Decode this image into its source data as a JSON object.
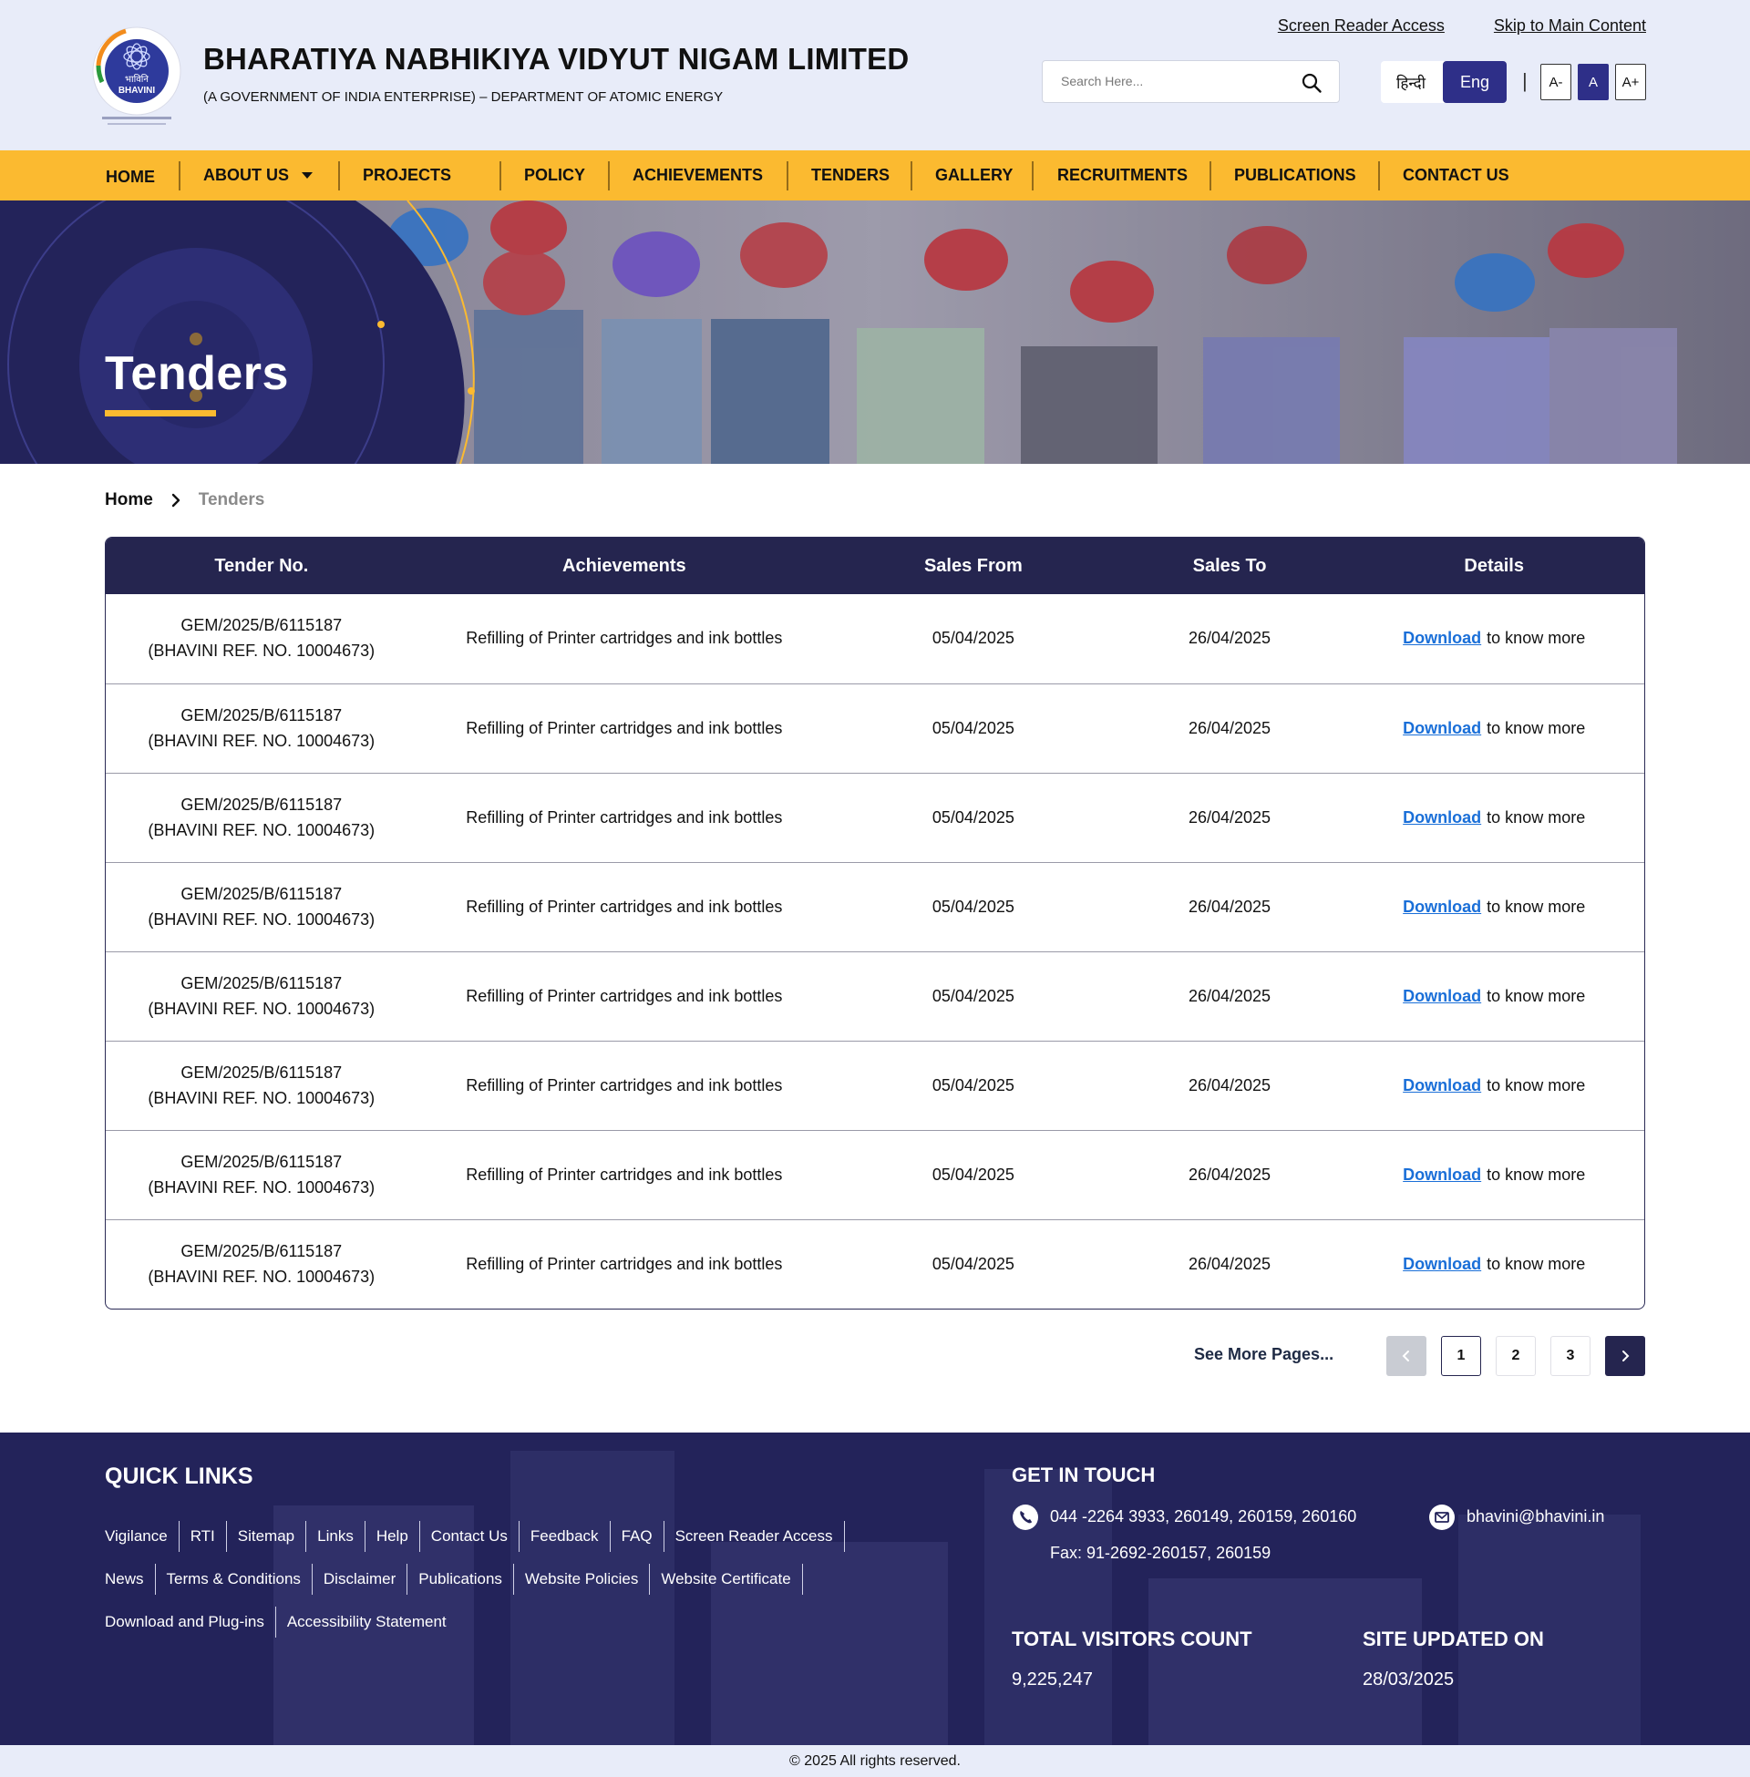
{
  "header": {
    "logo_text": "भाविनि BHAVINI",
    "org_name": "BHARATIYA NABHIKIYA VIDYUT NIGAM LIMITED",
    "org_subtitle": "(A GOVERNMENT OF INDIA ENTERPRISE) – DEPARTMENT OF ATOMIC ENERGY",
    "screen_reader_link": "Screen Reader Access",
    "skip_link": "Skip to Main Content",
    "search_placeholder": "Search Here...",
    "lang_hindi": "हिन्दी",
    "lang_english": "Eng",
    "divider": "|",
    "font_decrease": "A-",
    "font_normal": "A",
    "font_increase": "A+"
  },
  "nav": {
    "items": [
      {
        "label": "HOME"
      },
      {
        "label": "ABOUT US"
      },
      {
        "label": "PROJECTS"
      },
      {
        "label": "POLICY"
      },
      {
        "label": "ACHIEVEMENTS"
      },
      {
        "label": "TENDERS"
      },
      {
        "label": "GALLERY"
      },
      {
        "label": "RECRUITMENTS"
      },
      {
        "label": "PUBLICATIONS"
      },
      {
        "label": "CONTACT US"
      }
    ]
  },
  "banner": {
    "title": "Tenders"
  },
  "breadcrumb": {
    "home": "Home",
    "current": "Tenders"
  },
  "table": {
    "headers": [
      "Tender No.",
      "Achievements",
      "Sales From",
      "Sales To",
      "Details"
    ],
    "rows": [
      {
        "tender_line1": "GEM/2025/B/6115187",
        "tender_line2": "(BHAVINI REF. NO. 10004673)",
        "achievement": "Refilling of Printer cartridges and ink bottles",
        "sales_from": "05/04/2025",
        "sales_to": "26/04/2025",
        "link": "Download",
        "suffix": "to know more"
      },
      {
        "tender_line1": "GEM/2025/B/6115187",
        "tender_line2": "(BHAVINI REF. NO. 10004673)",
        "achievement": "Refilling of Printer cartridges and ink bottles",
        "sales_from": "05/04/2025",
        "sales_to": "26/04/2025",
        "link": "Download",
        "suffix": "to know more"
      },
      {
        "tender_line1": "GEM/2025/B/6115187",
        "tender_line2": "(BHAVINI REF. NO. 10004673)",
        "achievement": "Refilling of Printer cartridges and ink bottles",
        "sales_from": "05/04/2025",
        "sales_to": "26/04/2025",
        "link": "Download",
        "suffix": "to know more"
      },
      {
        "tender_line1": "GEM/2025/B/6115187",
        "tender_line2": "(BHAVINI REF. NO. 10004673)",
        "achievement": "Refilling of Printer cartridges and ink bottles",
        "sales_from": "05/04/2025",
        "sales_to": "26/04/2025",
        "link": "Download",
        "suffix": "to know more"
      },
      {
        "tender_line1": "GEM/2025/B/6115187",
        "tender_line2": "(BHAVINI REF. NO. 10004673)",
        "achievement": "Refilling of Printer cartridges and ink bottles",
        "sales_from": "05/04/2025",
        "sales_to": "26/04/2025",
        "link": "Download",
        "suffix": "to know more"
      },
      {
        "tender_line1": "GEM/2025/B/6115187",
        "tender_line2": "(BHAVINI REF. NO. 10004673)",
        "achievement": "Refilling of Printer cartridges and ink bottles",
        "sales_from": "05/04/2025",
        "sales_to": "26/04/2025",
        "link": "Download",
        "suffix": "to know more"
      },
      {
        "tender_line1": "GEM/2025/B/6115187",
        "tender_line2": "(BHAVINI REF. NO. 10004673)",
        "achievement": "Refilling of Printer cartridges and ink bottles",
        "sales_from": "05/04/2025",
        "sales_to": "26/04/2025",
        "link": "Download",
        "suffix": "to know more"
      },
      {
        "tender_line1": "GEM/2025/B/6115187",
        "tender_line2": "(BHAVINI REF. NO. 10004673)",
        "achievement": "Refilling of Printer cartridges and ink bottles",
        "sales_from": "05/04/2025",
        "sales_to": "26/04/2025",
        "link": "Download",
        "suffix": "to know more"
      }
    ]
  },
  "pagination": {
    "see_more": "See More Pages...",
    "pages": [
      "1",
      "2",
      "3"
    ],
    "current_page": "1"
  },
  "footer": {
    "quick_links_title": "QUICK LINKS",
    "quick_links_rows": [
      [
        "Vigilance",
        "RTI",
        "Sitemap",
        "Links",
        "Help",
        "Contact Us",
        "Feedback",
        "FAQ",
        "Screen Reader Access"
      ],
      [
        "News",
        "Terms & Conditions",
        "Disclaimer",
        "Publications",
        "Website Policies",
        "Website Certificate"
      ],
      [
        "Download and Plug-ins",
        "Accessibility Statement"
      ]
    ],
    "get_in_touch_title": "GET IN TOUCH",
    "phone": "044 -2264 3933, 260149, 260159, 260160",
    "fax": "Fax: 91-2692-260157, 260159",
    "email": "bhavini@bhavini.in",
    "visitors_label": "TOTAL VISITORS COUNT",
    "visitors_value": "9,225,247",
    "updated_label": "SITE UPDATED ON",
    "updated_value": "28/03/2025"
  },
  "copyright": "© 2025 All rights reserved.",
  "colors": {
    "header_bg": "#e8ecf9",
    "nav_bg": "#fbba30",
    "primary_navy": "#25254f",
    "link_blue": "#1a6fd8",
    "accent_yellow": "#fbba30"
  }
}
